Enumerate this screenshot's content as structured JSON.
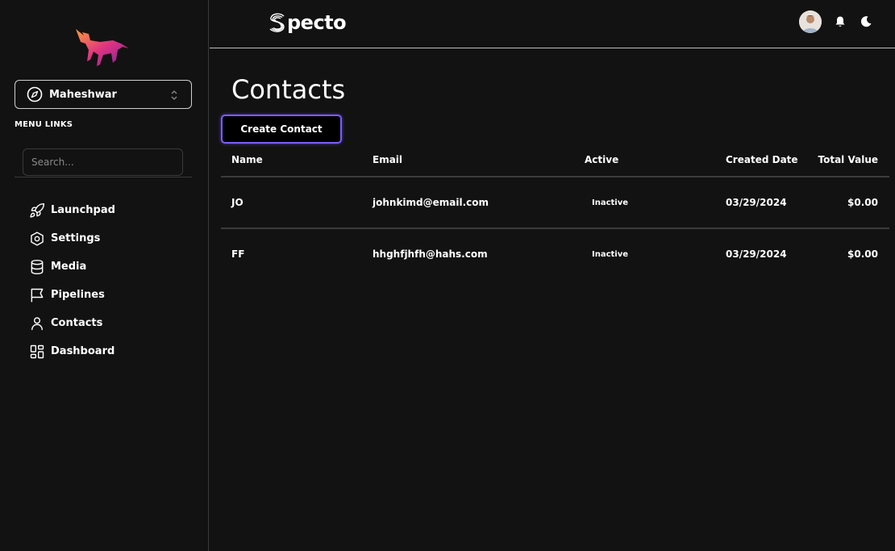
{
  "sidebar": {
    "account": {
      "name": "Maheshwar"
    },
    "menu_links_label": "MENU LINKS",
    "search": {
      "placeholder": "Search..."
    },
    "items": [
      {
        "label": "Launchpad",
        "icon": "rocket-icon"
      },
      {
        "label": "Settings",
        "icon": "hexagon-settings-icon"
      },
      {
        "label": "Media",
        "icon": "database-icon"
      },
      {
        "label": "Pipelines",
        "icon": "flag-icon"
      },
      {
        "label": "Contacts",
        "icon": "user-icon"
      },
      {
        "label": "Dashboard",
        "icon": "layout-grid-icon"
      }
    ]
  },
  "header": {
    "brand": "pecto",
    "icons": [
      "avatar",
      "bell-icon",
      "moon-icon"
    ]
  },
  "main": {
    "title": "Contacts",
    "create_button": "Create Contact",
    "table": {
      "headers": [
        "Name",
        "Email",
        "Active",
        "Created Date",
        "Total Value"
      ],
      "rows": [
        {
          "name": "JO",
          "email": "johnkimd@email.com",
          "active": "Inactive",
          "created": "03/29/2024",
          "total": "$0.00"
        },
        {
          "name": "FF",
          "email": "hhghfjhfh@hahs.com",
          "active": "Inactive",
          "created": "03/29/2024",
          "total": "$0.00"
        }
      ]
    }
  },
  "colors": {
    "background": "#121212",
    "accent": "#7c5cff",
    "divider": "#3c3c3c"
  }
}
